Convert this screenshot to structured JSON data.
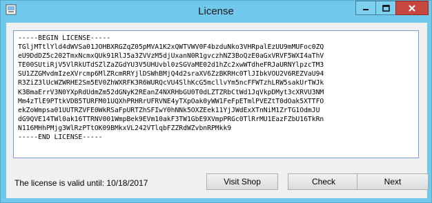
{
  "window": {
    "title": "License"
  },
  "license": {
    "lines": [
      "-----BEGIN LICENSE-----",
      "TGljMTtlYld4dWVSa01JOHBXRGZqZ05pMVA1K2xQWTVWV0F4bzduNko3VHRpalEzUU9mMUFoc0ZQ",
      "eU9DdDZ5c202TmxNcmxQUk91RlJ5a3ZVVzM5djUxanN0R1gvczhNZ3BoQzE0aGxVRVF5WXI4aThV",
      "TE00SUtiRjV5VlRkUTdSZlZaZGdYU3V5UHUvbl0zSGVaME02d1hZc2xwWTdheFRJaURNYlpzcTM3",
      "SU1ZZGMvdmIzeXVrcmp6MlZRcmRRYjlDSWhBMjQ4d2sraXV6ZzBKRHc0TlJIbkVOU2V6REZVaU94",
      "R3ZiZ3lUcWZWRHE2Sm5EV0ZhWXRFK3R6WURQcVU4SlhKcG5mcllvYm5ncFFWTzhLRW5sakUrTWJk",
      "K3BmaErrV3N0YXpRdUdmZm52dGNyK2REanZ4NXRHbGU0T0dLZTZRbCtWd1JqVkpDMyt3cXRVU3NM",
      "Mm4zTlE9PTtkVDB5TURFM01UQXhPRHRrUFRVNE4yTXpOak0yWW1FeFpETmlPVEZtT0dOak5XTTFO",
      "ekZoWmpsa01UUTRZVFE0WkRSaFpURTZhSFIwY0hNNk5OXZEek11YjJWdExXTnNiM1ZrTG1OdmJU",
      "dG9QVE14TWl0ak16TTRNV001WmpBek9EVm10akF3TW1GbE9XVmpPRGc0TlRrMU1EazFZbU16TkRn",
      "N116MHhPMjg3WlRzPTtOK09BMkxVL242VTlqbFZZRdWZvbnRPMkk9",
      "-----END LICENSE-----"
    ]
  },
  "status": {
    "valid_until": "The license is valid until: 10/18/2017"
  },
  "buttons": {
    "visit_shop": "Visit Shop",
    "check": "Check",
    "next": "Next"
  }
}
